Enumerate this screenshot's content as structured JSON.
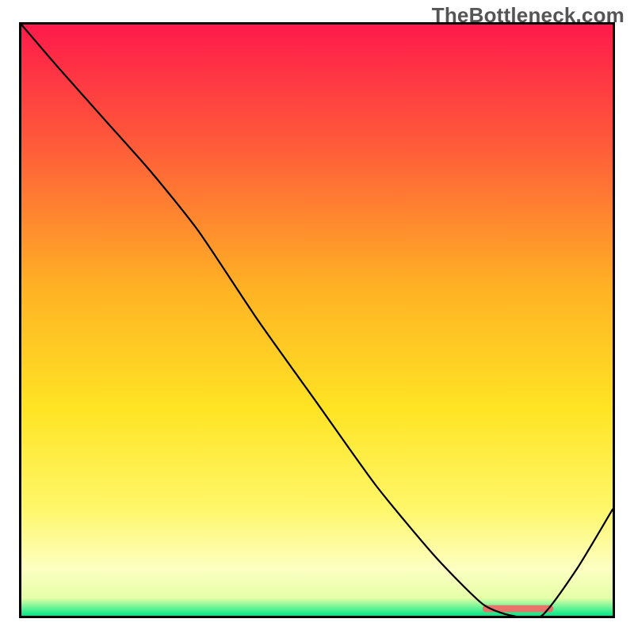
{
  "watermark": "TheBottleneck.com",
  "chart_data": {
    "type": "line",
    "title": "",
    "xlabel": "",
    "ylabel": "",
    "xlim": [
      0,
      100
    ],
    "ylim": [
      0,
      100
    ],
    "grid": false,
    "legend": false,
    "background_gradient": {
      "stops": [
        {
          "offset": 0.0,
          "color": "#ff1a4b"
        },
        {
          "offset": 0.2,
          "color": "#ff5a3a"
        },
        {
          "offset": 0.45,
          "color": "#ffb324"
        },
        {
          "offset": 0.65,
          "color": "#ffe424"
        },
        {
          "offset": 0.82,
          "color": "#fff76a"
        },
        {
          "offset": 0.92,
          "color": "#fdffc2"
        },
        {
          "offset": 0.97,
          "color": "#e6ffa8"
        },
        {
          "offset": 1.0,
          "color": "#00e887"
        }
      ]
    },
    "series": [
      {
        "name": "curve",
        "color": "#000000",
        "width": 3,
        "x": [
          0,
          6,
          14,
          22,
          30,
          40,
          50,
          60,
          70,
          78,
          83,
          88,
          94,
          100
        ],
        "y": [
          100,
          93,
          84,
          75,
          65,
          50,
          36,
          22,
          10,
          2,
          0,
          0,
          8,
          18
        ]
      }
    ],
    "marker_band": {
      "color": "#e8736b",
      "x_start": 78,
      "x_end": 90,
      "height_pct": 1.2,
      "y_bottom_pct": 0.6
    }
  }
}
